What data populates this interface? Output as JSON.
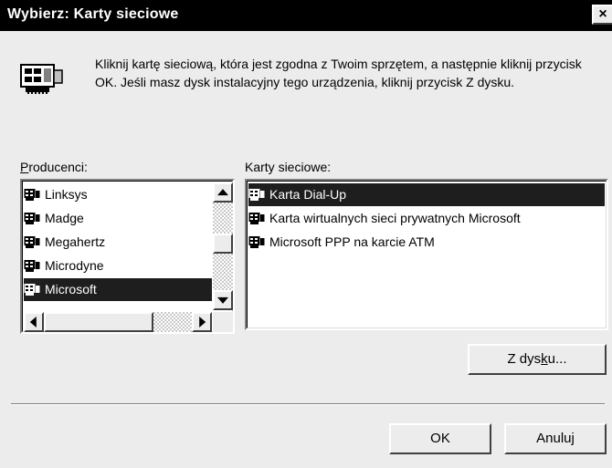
{
  "window": {
    "title": "Wybierz: Karty sieciowe",
    "close_glyph": "×"
  },
  "instructions": "Kliknij kartę sieciową, która jest zgodna z Twoim sprzętem, a następnie kliknij przycisk OK. Jeśli masz dysk instalacyjny tego urządzenia, kliknij przycisk Z dysku.",
  "manufacturers": {
    "label_accel": "P",
    "label_rest": "roducenci:",
    "items": [
      "Linksys",
      "Madge",
      "Megahertz",
      "Microdyne",
      "Microsoft"
    ],
    "selected": "Microsoft"
  },
  "adapters": {
    "label": "Karty sieciowe:",
    "items": [
      "Karta Dial-Up",
      "Karta wirtualnych sieci prywatnych Microsoft",
      "Microsoft PPP na karcie ATM"
    ],
    "selected": "Karta Dial-Up"
  },
  "buttons": {
    "have_disk_pre": "Z dys",
    "have_disk_accel": "k",
    "have_disk_post": "u...",
    "ok": "OK",
    "cancel": "Anuluj"
  },
  "icons": {
    "dialog_icon": "network-card-icon",
    "item_icon": "network-adapter-icon"
  }
}
